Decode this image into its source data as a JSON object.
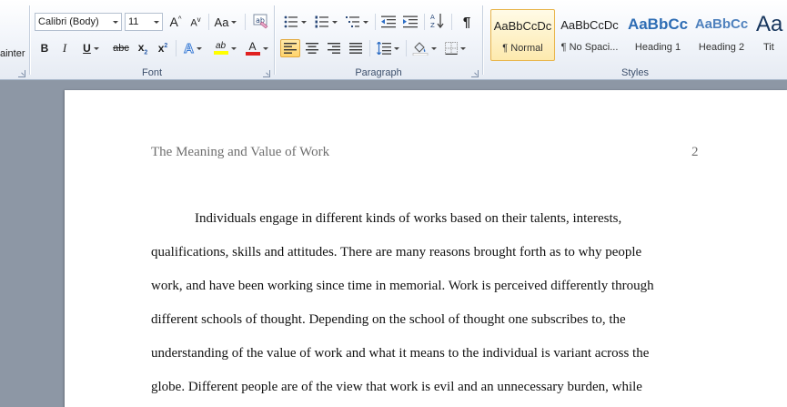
{
  "clipboard": {
    "format_painter_label": "ainter"
  },
  "font": {
    "group_label": "Font",
    "font_name": "Calibri (Body)",
    "font_size": "11",
    "grow_label": "A",
    "shrink_label": "A",
    "change_case_label": "Aa",
    "bold_label": "B",
    "italic_label": "I",
    "underline_label": "U",
    "strike_label": "abc",
    "subscript_label": "x",
    "subscript_mark": "2",
    "superscript_label": "x",
    "superscript_mark": "2",
    "effects_label": "A",
    "highlight_label": "ab",
    "color_label": "A",
    "highlight_color": "#ffff00",
    "font_color": "#e02020"
  },
  "paragraph": {
    "group_label": "Paragraph",
    "pilcrow_label": "¶"
  },
  "styles": {
    "group_label": "Styles",
    "items": [
      {
        "sample": "AaBbCcDc",
        "name": "¶ Normal",
        "selected": true
      },
      {
        "sample": "AaBbCcDc",
        "name": "¶ No Spaci...",
        "selected": false
      },
      {
        "sample": "AaBbCc",
        "name": "Heading 1",
        "selected": false
      },
      {
        "sample": "AaBbCc",
        "name": "Heading 2",
        "selected": false
      },
      {
        "sample": "Aa",
        "name": "Tit",
        "selected": false
      }
    ],
    "heading_color": "#17365d",
    "heading1_color": "#2e6db4",
    "heading2_color": "#4f81bd"
  },
  "document": {
    "header_title": "The Meaning and Value of Work",
    "page_number": "2",
    "lines": [
      "Individuals engage in different kinds of works based on their talents, interests,",
      "qualifications, skills  and attitudes. There are many reasons brought forth as to why people",
      "work, and have been working since time in memorial.  Work is perceived differently through",
      "different schools of thought. Depending on the school of thought one subscribes to, the",
      "understanding of the value of work and what it means to the individual is variant across the",
      "globe. Different people are of the view that work is evil and an unnecessary burden, while"
    ]
  }
}
